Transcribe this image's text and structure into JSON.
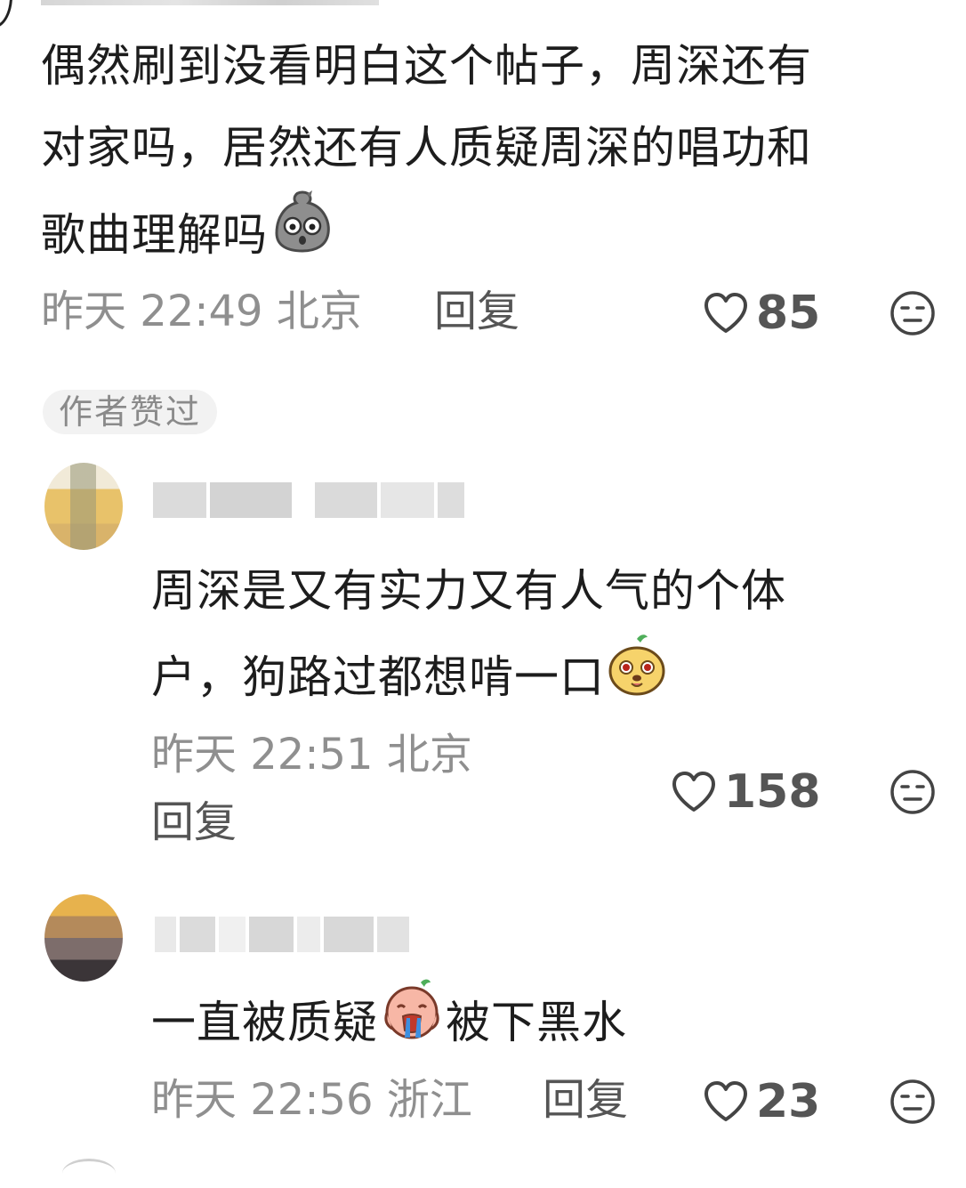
{
  "comments": [
    {
      "text": "偶然刷到没看明白这个帖子，周深还有对家吗，居然还有人质疑周深的唱功和歌曲理解吗",
      "line1": "偶然刷到没看明白这个帖子，周深还有",
      "line2": "对家吗，居然还有人质疑周深的唱功和",
      "line3": "歌曲理解吗",
      "emoji": "scared-rock-emoji",
      "time": "昨天 22:49",
      "location": "北京",
      "reply_label": "回复",
      "likes": "85",
      "author_liked_badge": "作者赞过"
    },
    {
      "line1": "周深是又有实力又有人气的个体",
      "line2": "户，狗路过都想啃一口",
      "emoji": "drooling-dog-emoji",
      "time": "昨天 22:51",
      "location": "北京",
      "reply_label": "回复",
      "likes": "158"
    },
    {
      "line_before": "一直被质疑",
      "line_after": "被下黑水",
      "emoji": "crying-face-emoji",
      "time": "昨天 22:56",
      "location": "浙江",
      "reply_label": "回复",
      "likes": "23"
    }
  ],
  "icons": {
    "like": "heart-outline-icon",
    "dislike": "expressionless-face-icon"
  },
  "colors": {
    "text": "#1d1d1d",
    "meta": "#8f8f8f",
    "secondary": "#555555",
    "badge_bg": "#f2f2f2"
  }
}
